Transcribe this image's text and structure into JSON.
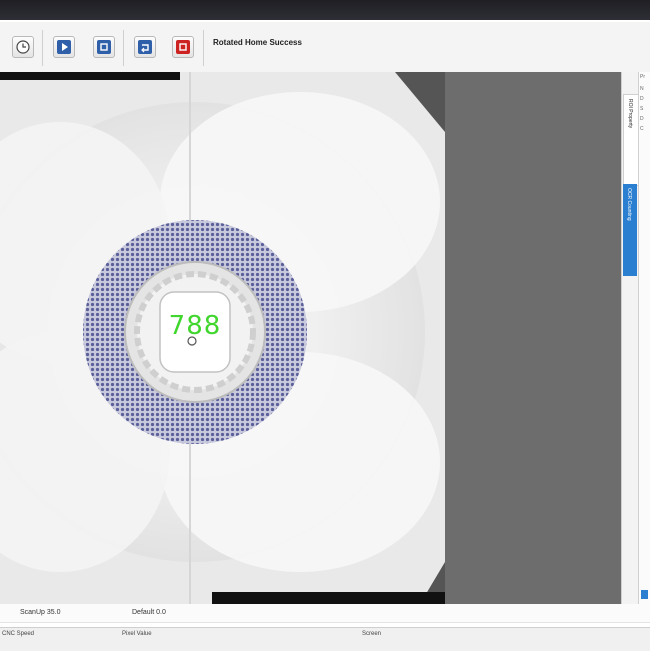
{
  "toolbar": {
    "status_message": "Rotated Home Success",
    "buttons": [
      {
        "name": "clock-icon"
      },
      {
        "name": "play-icon",
        "color": "#2e5fa8"
      },
      {
        "name": "stop-icon",
        "color": "#2e5fa8"
      },
      {
        "name": "return-icon",
        "color": "#2e5fa8"
      },
      {
        "name": "stop-red-icon",
        "color": "#cc2222"
      }
    ]
  },
  "viewer": {
    "count": "788",
    "count_color": "#41d62e",
    "part_color": "#5a5f9a"
  },
  "side_tabs": [
    {
      "label": "ROI Property",
      "active": false
    },
    {
      "label": "OCR Counting",
      "active": true,
      "color": "#2a7fd0"
    }
  ],
  "side_list": [
    "Pr",
    "N",
    "D",
    "S",
    "D",
    "C"
  ],
  "readout": {
    "scan_up": "ScanUp 35.0",
    "default": "Default 0.0"
  },
  "statusbar": {
    "cnc_speed": "CNC Speed",
    "pixel_value": "Pixel Value",
    "screen": "Screen"
  }
}
